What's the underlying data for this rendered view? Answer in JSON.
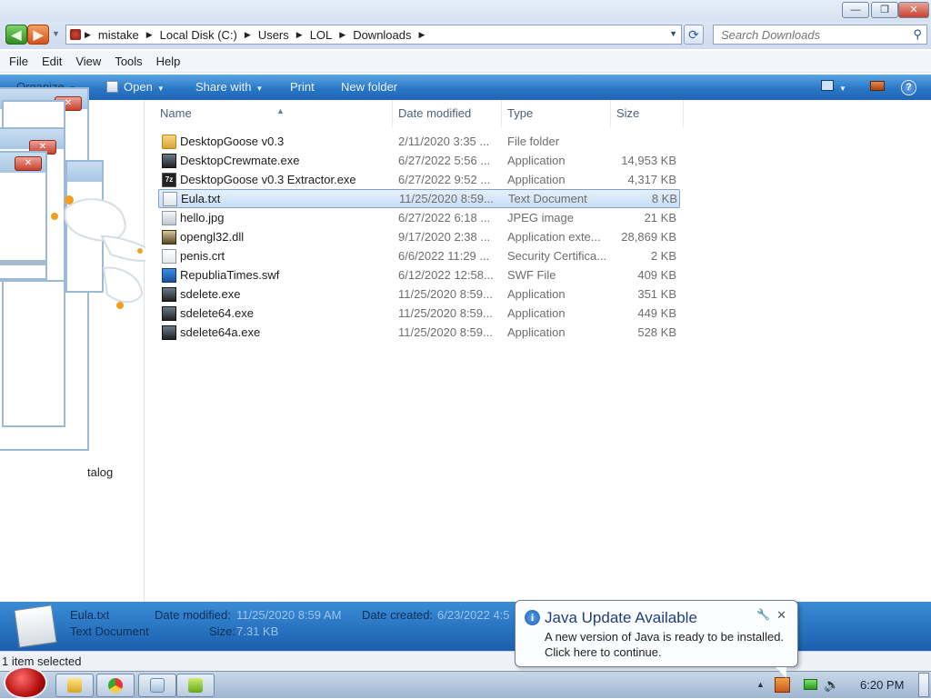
{
  "window": {
    "minimize": "—",
    "maximize": "❐",
    "close": "✕"
  },
  "address": {
    "crumbs": [
      "mistake",
      "Local Disk (C:)",
      "Users",
      "LOL",
      "Downloads"
    ],
    "search_placeholder": "Search Downloads"
  },
  "menu": [
    "File",
    "Edit",
    "View",
    "Tools",
    "Help"
  ],
  "toolbar": {
    "organize": "Organize",
    "open": "Open",
    "share_with": "Share with",
    "print": "Print",
    "new_folder": "New folder"
  },
  "columns": {
    "name": "Name",
    "date": "Date modified",
    "type": "Type",
    "size": "Size"
  },
  "files": [
    {
      "name": "DesktopGoose v0.3",
      "date": "2/11/2020 3:35 ...",
      "type": "File folder",
      "size": "",
      "icon": "folder-icon"
    },
    {
      "name": "DesktopCrewmate.exe",
      "date": "6/27/2022 5:56 ...",
      "type": "Application",
      "size": "14,953 KB",
      "icon": "application-icon"
    },
    {
      "name": "DesktopGoose v0.3 Extractor.exe",
      "date": "6/27/2022 9:52 ...",
      "type": "Application",
      "size": "4,317 KB",
      "icon": "7z-archive-icon"
    },
    {
      "name": "Eula.txt",
      "date": "11/25/2020 8:59...",
      "type": "Text Document",
      "size": "8 KB",
      "icon": "text-document-icon"
    },
    {
      "name": "hello.jpg",
      "date": "6/27/2022 6:18 ...",
      "type": "JPEG image",
      "size": "21 KB",
      "icon": "image-icon"
    },
    {
      "name": "opengl32.dll",
      "date": "9/17/2020 2:38 ...",
      "type": "Application exte...",
      "size": "28,869 KB",
      "icon": "dll-icon"
    },
    {
      "name": "penis.crt",
      "date": "6/6/2022 11:29 ...",
      "type": "Security Certifica...",
      "size": "2 KB",
      "icon": "certificate-icon"
    },
    {
      "name": "RepubliaTimes.swf",
      "date": "6/12/2022 12:58...",
      "type": "SWF File",
      "size": "409 KB",
      "icon": "swf-icon"
    },
    {
      "name": "sdelete.exe",
      "date": "11/25/2020 8:59...",
      "type": "Application",
      "size": "351 KB",
      "icon": "application-icon"
    },
    {
      "name": "sdelete64.exe",
      "date": "11/25/2020 8:59...",
      "type": "Application",
      "size": "449 KB",
      "icon": "application-icon"
    },
    {
      "name": "sdelete64a.exe",
      "date": "11/25/2020 8:59...",
      "type": "Application",
      "size": "528 KB",
      "icon": "application-icon"
    }
  ],
  "selected_index": 3,
  "nav_pane": {
    "partial_label": "talog"
  },
  "details": {
    "name": "Eula.txt",
    "type": "Text Document",
    "modified_label": "Date modified:",
    "modified_value": "11/25/2020 8:59 AM",
    "created_label": "Date created:",
    "created_value": "6/23/2022 4:5",
    "size_label": "Size:",
    "size_value": "7.31 KB"
  },
  "status": {
    "text": "1 item selected"
  },
  "notification": {
    "title": "Java Update Available",
    "line1": "A new version of Java is ready to be installed.",
    "line2": "Click here to continue."
  },
  "taskbar": {
    "clock": "6:20 PM"
  }
}
